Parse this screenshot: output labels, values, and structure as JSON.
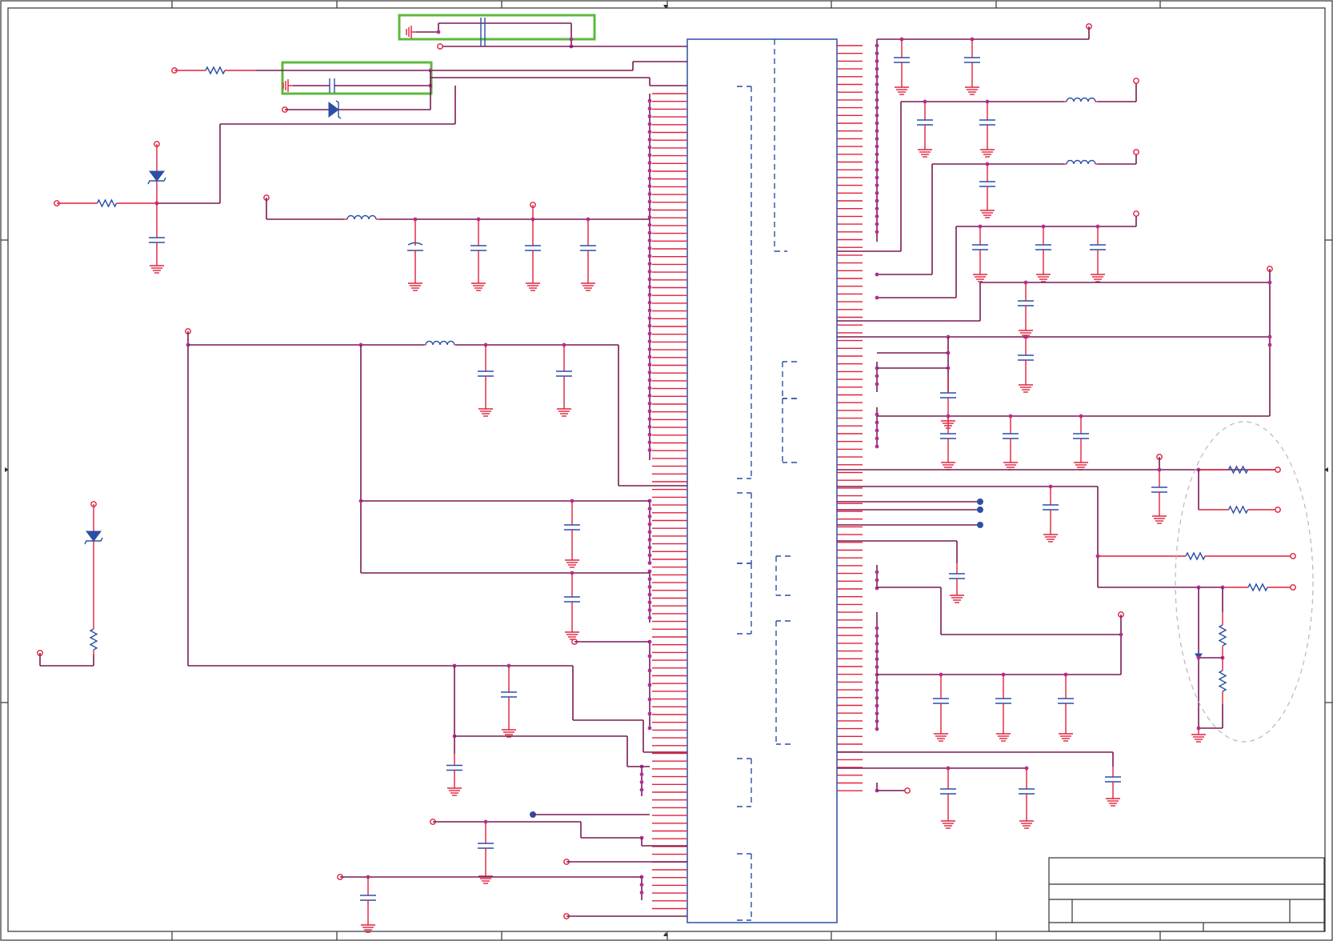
{
  "colors": {
    "wire": "#7a1a52",
    "pin": "#e0203a",
    "component": "#2b4fa6",
    "junction": "#b0309a",
    "highlight": "#5cba3c",
    "guide_oval": "#b8b8b8"
  },
  "highlights": 2,
  "icons": [
    "resistor-icon",
    "capacitor-icon",
    "inductor-icon",
    "diode-icon",
    "zener-diode-icon",
    "ground-icon",
    "port-icon"
  ]
}
